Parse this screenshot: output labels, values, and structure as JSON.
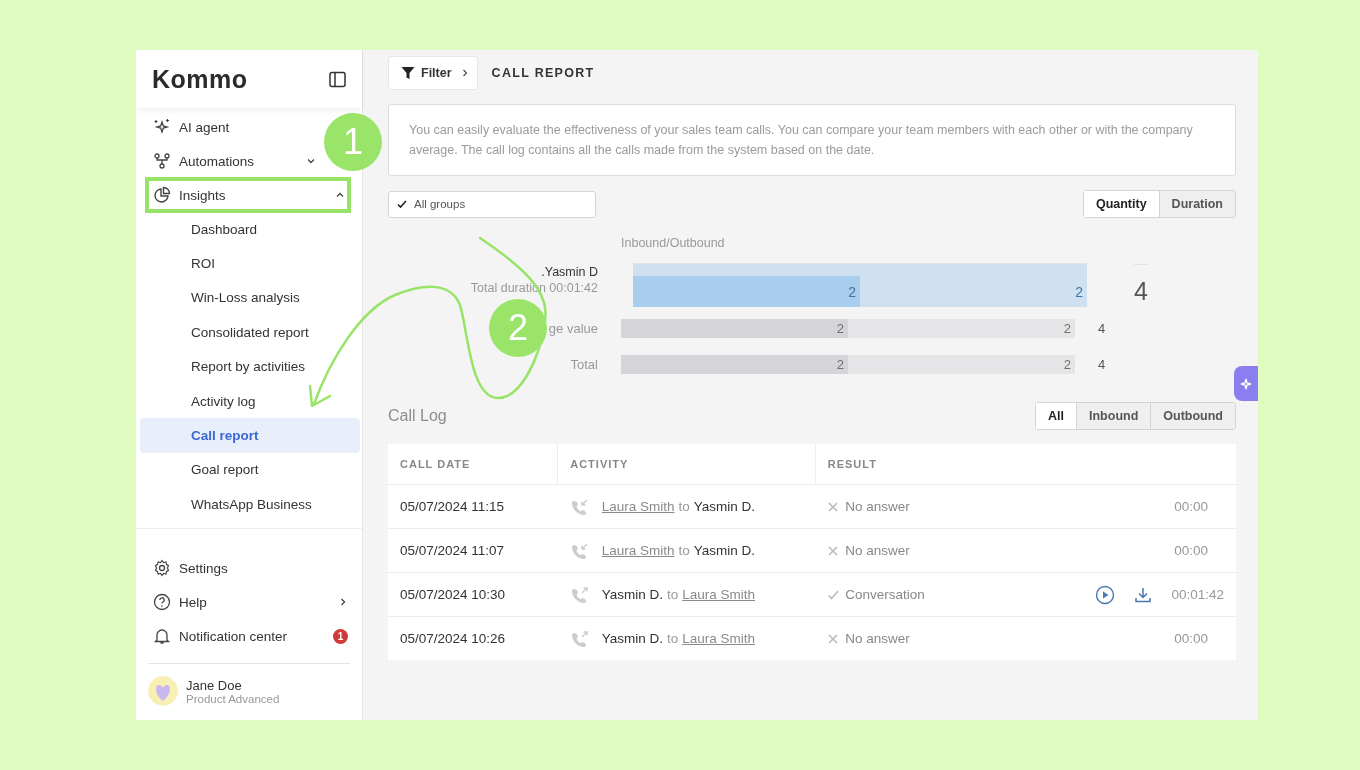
{
  "sidebar": {
    "logo": "Kommo",
    "nav": [
      {
        "label": "AI agent",
        "highlighted": false
      },
      {
        "label": "Automations",
        "expanded": false,
        "highlighted": false
      },
      {
        "label": "Insights",
        "expanded": true,
        "highlighted": true,
        "children": [
          {
            "label": "Dashboard",
            "selected": false
          },
          {
            "label": "ROI",
            "selected": false
          },
          {
            "label": "Win-Loss analysis",
            "selected": false
          },
          {
            "label": "Consolidated report",
            "selected": false
          },
          {
            "label": "Report by activities",
            "selected": false
          },
          {
            "label": "Activity log",
            "selected": false
          },
          {
            "label": "Call report",
            "selected": true
          },
          {
            "label": "Goal report",
            "selected": false
          },
          {
            "label": "WhatsApp Business",
            "selected": false
          }
        ]
      }
    ],
    "bottom": [
      {
        "label": "Settings",
        "kind": "link"
      },
      {
        "label": "Help",
        "kind": "submenu"
      },
      {
        "label": "Notification center",
        "kind": "notifications",
        "badge": "1"
      }
    ],
    "user": {
      "name": "Jane Doe",
      "plan": "Product Advanced"
    }
  },
  "header": {
    "filter": "Filter",
    "title": "CALL REPORT"
  },
  "description": "You can easily evaluate the effectiveness of your sales team calls. You can compare your team members with each other or with the company average. The call log contains all the calls made from the system based on the date.",
  "groups": {
    "label": "All groups",
    "checked": true
  },
  "mode_tabs": [
    {
      "label": "Quantity",
      "selected": true
    },
    {
      "label": "Duration",
      "selected": false
    }
  ],
  "chart": {
    "heading": "Inbound/Outbound",
    "rows": [
      {
        "kind": "user",
        "label": ".Yasmin D",
        "sublabel": "Total duration 00:01:42",
        "level": 0.5,
        "inbound": "2",
        "outbound": "2",
        "total": "4"
      },
      {
        "kind": "summary",
        "label": "ge value",
        "level": 0.5,
        "inbound": "2",
        "outbound": "2",
        "total": "4"
      },
      {
        "kind": "summary",
        "label": "Total",
        "level": 0.5,
        "inbound": "2",
        "outbound": "2",
        "total": "4"
      }
    ]
  },
  "call_log": {
    "title": "Call Log",
    "tabs": [
      {
        "label": "All",
        "selected": true
      },
      {
        "label": "Inbound",
        "selected": false
      },
      {
        "label": "Outbound",
        "selected": false
      }
    ],
    "columns": [
      "CALL DATE",
      "ACTIVITY",
      "RESULT"
    ],
    "rows": [
      {
        "date": "05/07/2024 11:15",
        "inbound": true,
        "from": "Laura Smith",
        "joiner": "to",
        "to": "Yasmin D.",
        "answered": false,
        "result": "No answer",
        "duration": "00:00",
        "recording": false
      },
      {
        "date": "05/07/2024 11:07",
        "inbound": true,
        "from": "Laura Smith",
        "joiner": "to",
        "to": "Yasmin D.",
        "answered": false,
        "result": "No answer",
        "duration": "00:00",
        "recording": false
      },
      {
        "date": "05/07/2024 10:30",
        "inbound": false,
        "from": "Yasmin D.",
        "joiner": "to",
        "to": "Laura Smith",
        "answered": true,
        "result": "Conversation",
        "duration": "00:01:42",
        "recording": true
      },
      {
        "date": "05/07/2024 10:26",
        "inbound": false,
        "from": "Yasmin D.",
        "joiner": "to",
        "to": "Laura Smith",
        "answered": false,
        "result": "No answer",
        "duration": "00:00",
        "recording": false
      }
    ]
  },
  "annotations": [
    {
      "kind": "step",
      "label": "1"
    },
    {
      "kind": "step",
      "label": "2"
    }
  ]
}
